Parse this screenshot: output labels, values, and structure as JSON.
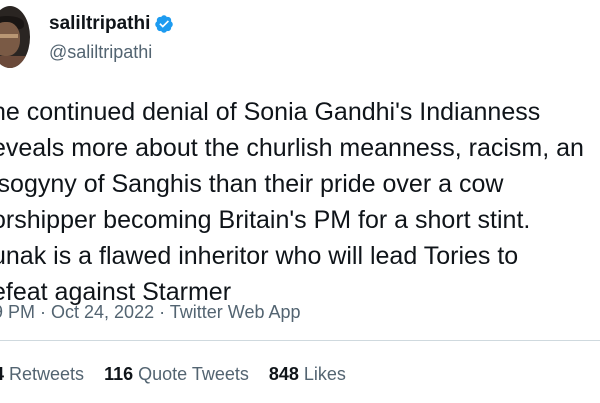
{
  "author": {
    "display_name": "saliltripathi",
    "handle": "@saliltripathi",
    "verified": true,
    "verified_color": "#1d9bf0"
  },
  "tweet": {
    "lines": [
      "he continued denial of Sonia Gandhi's Indianness",
      "eveals more about the churlish meanness, racism, an",
      "isogyny of Sanghis than their pride over a cow",
      "orshipper becoming Britain's PM for a short stint.",
      "unak is a flawed inheritor who will lead Tories to",
      "efeat against Starmer"
    ]
  },
  "meta": {
    "time": "9 PM",
    "separator_1": " · ",
    "date": "Oct 24, 2022",
    "separator_2": " · ",
    "source": "Twitter Web App"
  },
  "stats": {
    "retweets_count": "4",
    "retweets_label": "Retweets",
    "quotes_count": "116",
    "quotes_label": "Quote Tweets",
    "likes_count": "848",
    "likes_label": "Likes"
  }
}
